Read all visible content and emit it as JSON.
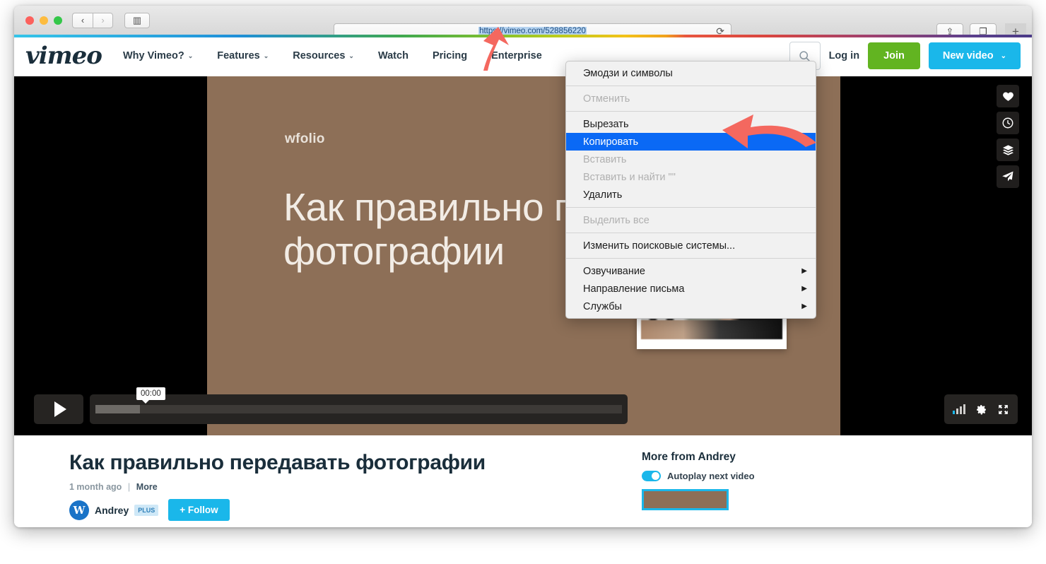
{
  "browser": {
    "back_label": "‹",
    "forward_label": "›",
    "sidebar_label": "▥",
    "url": "https://vimeo.com/528856220",
    "reload_label": "⟳",
    "share_label": "⇪",
    "tabs_label": "❐",
    "new_tab_label": "+"
  },
  "site": {
    "logo": "vimeo",
    "nav": [
      {
        "label": "Why Vimeo?",
        "caret": "⌄"
      },
      {
        "label": "Features",
        "caret": "⌄"
      },
      {
        "label": "Resources",
        "caret": "⌄"
      },
      {
        "label": "Watch",
        "caret": ""
      },
      {
        "label": "Pricing",
        "caret": ""
      },
      {
        "label": "Enterprise",
        "caret": ""
      }
    ],
    "search_icon": "search-icon",
    "login_label": "Log in",
    "join_label": "Join",
    "new_video_label": "New video",
    "new_video_caret": "⌄",
    "accent_blue": "#1ab7ea",
    "accent_green": "#62b421"
  },
  "player": {
    "brand": "wfolio",
    "slide_title": "Как правильно передавать фотографии",
    "current_time": "00:00",
    "play_label": "▶",
    "rail": [
      {
        "name": "like-icon",
        "glyph": "♥"
      },
      {
        "name": "watch-later-icon",
        "glyph": "🕐"
      },
      {
        "name": "add-to-collection-icon",
        "glyph": "≋"
      },
      {
        "name": "share-icon",
        "glyph": "➤"
      }
    ],
    "settings_icon": "gear-icon",
    "fullscreen_icon": "fullscreen-icon",
    "volume_icon": "volume-icon",
    "background_color": "#8d6f57"
  },
  "video": {
    "title": "Как правильно передавать фотографии",
    "uploaded": "1 month ago",
    "separator": "|",
    "more_label": "More",
    "uploader": "Andrey",
    "uploader_initial": "W",
    "plus_badge": "PLUS",
    "follow_label": "+ Follow"
  },
  "sidebar": {
    "title": "More from Andrey",
    "autoplay_label": "Autoplay next video",
    "autoplay_on": true
  },
  "context_menu": {
    "items": [
      {
        "label": "Эмодзи и символы",
        "state": "normal",
        "submenu": false
      },
      {
        "sep": true
      },
      {
        "label": "Отменить",
        "state": "disabled",
        "submenu": false
      },
      {
        "sep": true
      },
      {
        "label": "Вырезать",
        "state": "normal",
        "submenu": false
      },
      {
        "label": "Копировать",
        "state": "selected",
        "submenu": false
      },
      {
        "label": "Вставить",
        "state": "disabled",
        "submenu": false
      },
      {
        "label": "Вставить и найти \"\"",
        "state": "disabled",
        "submenu": false
      },
      {
        "label": "Удалить",
        "state": "normal",
        "submenu": false
      },
      {
        "sep": true
      },
      {
        "label": "Выделить все",
        "state": "disabled",
        "submenu": false
      },
      {
        "sep": true
      },
      {
        "label": "Изменить поисковые системы...",
        "state": "normal",
        "submenu": false
      },
      {
        "sep": true
      },
      {
        "label": "Озвучивание",
        "state": "normal",
        "submenu": true,
        "arrow": "▶"
      },
      {
        "label": "Направление письма",
        "state": "normal",
        "submenu": true,
        "arrow": "▶"
      },
      {
        "label": "Службы",
        "state": "normal",
        "submenu": true,
        "arrow": "▶"
      }
    ]
  }
}
